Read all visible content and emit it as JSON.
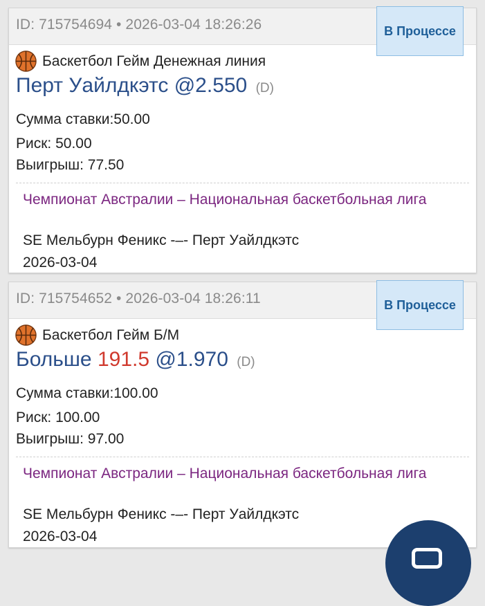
{
  "bets": [
    {
      "id_label": "ID: 715754694",
      "datetime": "2026-03-04 18:26:26",
      "status": "В Процессе",
      "sport_market": "Баскетбол Гейм Денежная линия",
      "selection_team": "Перт Уайлдкэтс",
      "odds": "@2.550",
      "selection_type": "(D)",
      "stake": "Сумма ставки:50.00",
      "risk": "Риск: 50.00",
      "win": "Выигрыш: 77.50",
      "league": "Чемпионат Австралии – Национальная баскетбольная лига",
      "event": "SE Мельбурн Феникс -–- Перт Уайлдкэтс",
      "event_date": "2026-03-04"
    },
    {
      "id_label": "ID: 715754652",
      "datetime": "2026-03-04 18:26:11",
      "status": "В Процессе",
      "sport_market": "Баскетбол Гейм Б/М",
      "selection_word": "Больше",
      "selection_total": "191.5",
      "odds": "@1.970",
      "selection_type": "(D)",
      "stake": "Сумма ставки:100.00",
      "risk": "Риск: 100.00",
      "win": "Выигрыш: 97.00",
      "league": "Чемпионат Австралии – Национальная баскетбольная лига",
      "event": "SE Мельбурн Феникс -–- Перт Уайлдкэтс",
      "event_date": "2026-03-04"
    }
  ],
  "icons": {
    "sport": "basketball-icon"
  },
  "colors": {
    "selection": "#2b4f8a",
    "total": "#d03a2e",
    "league": "#7b2680",
    "status_bg": "#d5e8f8",
    "status_text": "#1f5f99",
    "fab": "#1c3f6e"
  }
}
